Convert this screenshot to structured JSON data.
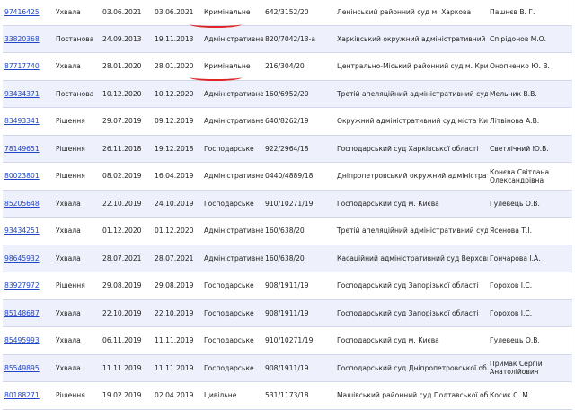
{
  "rows": [
    {
      "id": "97416425",
      "type": "Ухвала",
      "date_reg": "03.06.2021",
      "date_pub": "03.06.2021",
      "form": "Кримінальне",
      "case_no": "642/3152/20",
      "court": "Ленінський районний суд м. Харкова",
      "judge": "Пашнєв В. Г."
    },
    {
      "id": "33820368",
      "type": "Постанова",
      "date_reg": "24.09.2013",
      "date_pub": "19.11.2013",
      "form": "Адміністративне",
      "case_no": "820/7042/13-а",
      "court": "Харківський окружний адміністративний суд",
      "judge": "Спірідонов М.О."
    },
    {
      "id": "87717740",
      "type": "Ухвала",
      "date_reg": "28.01.2020",
      "date_pub": "28.01.2020",
      "form": "Кримінальне",
      "case_no": "216/304/20",
      "court": "Центрально-Міський районний суд м. Кривого Рогу",
      "judge": "Онопченко Ю. В."
    },
    {
      "id": "93434371",
      "type": "Постанова",
      "date_reg": "10.12.2020",
      "date_pub": "10.12.2020",
      "form": "Адміністративне",
      "case_no": "160/6952/20",
      "court": "Третій апеляційний адміністративний суд",
      "judge": "Мельник В.В."
    },
    {
      "id": "83493341",
      "type": "Рішення",
      "date_reg": "29.07.2019",
      "date_pub": "09.12.2019",
      "form": "Адміністративне",
      "case_no": "640/8262/19",
      "court": "Окружний адміністративний суд міста Києва",
      "judge": "Літвінова А.В."
    },
    {
      "id": "78149651",
      "type": "Рішення",
      "date_reg": "26.11.2018",
      "date_pub": "19.12.2018",
      "form": "Господарське",
      "case_no": "922/2964/18",
      "court": "Господарський суд Харківської області",
      "judge": "Светлічний Ю.В."
    },
    {
      "id": "80023801",
      "type": "Рішення",
      "date_reg": "08.02.2019",
      "date_pub": "16.04.2019",
      "form": "Адміністративне",
      "case_no": "0440/4889/18",
      "court": "Дніпропетровський окружний адміністративний суд",
      "judge": "Конєва Світлана Олександрівна"
    },
    {
      "id": "85205648",
      "type": "Ухвала",
      "date_reg": "22.10.2019",
      "date_pub": "24.10.2019",
      "form": "Господарське",
      "case_no": "910/10271/19",
      "court": "Господарський суд м. Києва",
      "judge": "Гулевець О.В."
    },
    {
      "id": "93434251",
      "type": "Ухвала",
      "date_reg": "01.12.2020",
      "date_pub": "01.12.2020",
      "form": "Адміністративне",
      "case_no": "160/638/20",
      "court": "Третій апеляційний адміністративний суд",
      "judge": "Ясенова Т.І."
    },
    {
      "id": "98645932",
      "type": "Ухвала",
      "date_reg": "28.07.2021",
      "date_pub": "28.07.2021",
      "form": "Адміністративне",
      "case_no": "160/638/20",
      "court": "Касаційний адміністративний суд Верховного Суду",
      "judge": "Гончарова І.А."
    },
    {
      "id": "83927972",
      "type": "Рішення",
      "date_reg": "29.08.2019",
      "date_pub": "29.08.2019",
      "form": "Господарське",
      "case_no": "908/1911/19",
      "court": "Господарський суд Запорізької області",
      "judge": "Горохов І.С."
    },
    {
      "id": "85148687",
      "type": "Ухвала",
      "date_reg": "22.10.2019",
      "date_pub": "22.10.2019",
      "form": "Господарське",
      "case_no": "908/1911/19",
      "court": "Господарський суд Запорізької області",
      "judge": "Горохов І.С."
    },
    {
      "id": "85495993",
      "type": "Ухвала",
      "date_reg": "06.11.2019",
      "date_pub": "11.11.2019",
      "form": "Господарське",
      "case_no": "910/10271/19",
      "court": "Господарський суд м. Києва",
      "judge": "Гулевець О.В."
    },
    {
      "id": "85549895",
      "type": "Ухвала",
      "date_reg": "11.11.2019",
      "date_pub": "11.11.2019",
      "form": "Господарське",
      "case_no": "908/1911/19",
      "court": "Господарський суд Дніпропетровської області",
      "judge": "Примак Сергій Анатолійович"
    },
    {
      "id": "80188271",
      "type": "Рішення",
      "date_reg": "19.02.2019",
      "date_pub": "02.04.2019",
      "form": "Цивільне",
      "case_no": "531/1173/18",
      "court": "Машівський районний суд Полтавської області",
      "judge": "Косик С. М."
    }
  ]
}
